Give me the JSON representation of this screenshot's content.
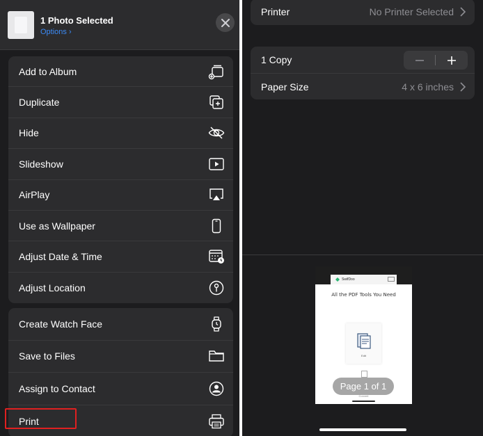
{
  "share_sheet": {
    "header": {
      "title": "1 Photo Selected",
      "options_label": "Options"
    },
    "group1": [
      {
        "label": "Add to Album",
        "icon": "add-to-album-icon"
      },
      {
        "label": "Duplicate",
        "icon": "duplicate-icon"
      },
      {
        "label": "Hide",
        "icon": "hide-icon"
      },
      {
        "label": "Slideshow",
        "icon": "play-icon"
      },
      {
        "label": "AirPlay",
        "icon": "airplay-icon"
      },
      {
        "label": "Use as Wallpaper",
        "icon": "phone-icon"
      },
      {
        "label": "Adjust Date & Time",
        "icon": "calendar-clock-icon"
      },
      {
        "label": "Adjust Location",
        "icon": "location-icon"
      }
    ],
    "group2": [
      {
        "label": "Create Watch Face",
        "icon": "watch-icon"
      },
      {
        "label": "Save to Files",
        "icon": "folder-icon"
      },
      {
        "label": "Assign to Contact",
        "icon": "contact-icon"
      },
      {
        "label": "Print",
        "icon": "printer-icon"
      }
    ]
  },
  "print_options": {
    "printer": {
      "label": "Printer",
      "value": "No Printer Selected"
    },
    "copies": {
      "label": "1 Copy",
      "minus": "−",
      "plus": "+"
    },
    "paper_size": {
      "label": "Paper Size",
      "value": "4 x 6 inches"
    },
    "preview": {
      "page_indicator": "Page 1 of 1",
      "thumb": {
        "logo_text": "SwifDoo",
        "heading": "All the PDF Tools You Need",
        "card_label": "Edit",
        "footer_label": "Convert"
      }
    }
  },
  "colors": {
    "background": "#1c1c1e",
    "group_bg": "#2c2c2e",
    "link_blue": "#3b8af5",
    "highlight_red": "#e02020"
  }
}
